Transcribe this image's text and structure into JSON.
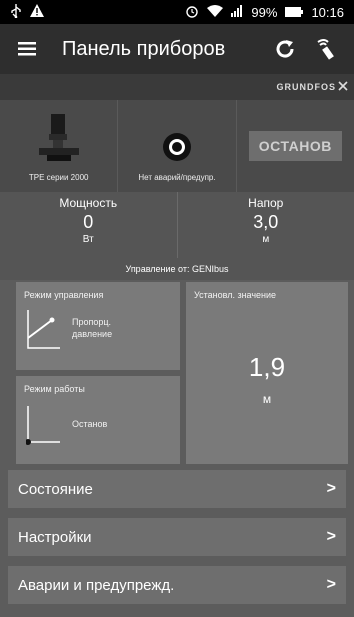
{
  "status_bar": {
    "battery": "99%",
    "time": "10:16"
  },
  "appbar": {
    "title": "Панель приборов"
  },
  "brand": {
    "name": "GRUNDFOS"
  },
  "top_panel": {
    "pump_label": "TPE серии 2000",
    "alarm_label": "Нет аварий/предупр.",
    "stop_button": "ОСТАНОВ"
  },
  "metrics": {
    "power": {
      "label": "Мощность",
      "value": "0",
      "unit": "Вт"
    },
    "head": {
      "label": "Напор",
      "value": "3,0",
      "unit": "м"
    }
  },
  "control": {
    "text": "Управление от: GENIbus"
  },
  "tiles": {
    "control_mode": {
      "label": "Режим управления",
      "value_line1": "Пропорц.",
      "value_line2": "давление"
    },
    "operation_mode": {
      "label": "Режим работы",
      "value": "Останов"
    },
    "setpoint": {
      "label": "Установл. значение",
      "value": "1,9",
      "unit": "м"
    }
  },
  "menu": {
    "items": [
      {
        "label": "Состояние"
      },
      {
        "label": "Настройки"
      },
      {
        "label": "Аварии и предупрежд."
      }
    ]
  },
  "icons": [
    "usb-icon",
    "warning-icon",
    "alarm-clock-icon",
    "wifi-icon",
    "signal-icon",
    "battery-icon",
    "menu-icon",
    "refresh-icon",
    "remote-icon",
    "pump-icon",
    "alarm-status-icon",
    "chevron-right-icon"
  ]
}
